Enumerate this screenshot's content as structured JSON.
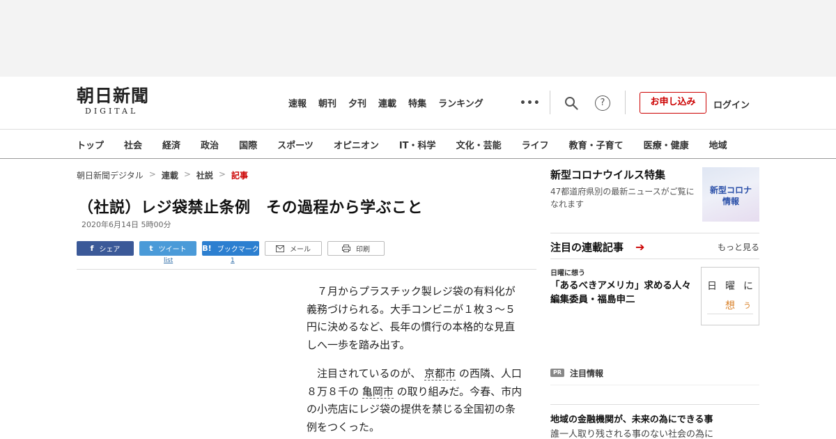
{
  "logo": {
    "main": "朝日新聞",
    "sub": "DIGITAL"
  },
  "topnav": [
    "速報",
    "朝刊",
    "夕刊",
    "連載",
    "特集",
    "ランキング"
  ],
  "header": {
    "more": "•••",
    "help": "?",
    "apply_label": "お申し込み",
    "login_label": "ログイン"
  },
  "catnav": [
    "トップ",
    "社会",
    "経済",
    "政治",
    "国際",
    "スポーツ",
    "オピニオン",
    "IT・科学",
    "文化・芸能",
    "ライフ",
    "教育・子育て",
    "医療・健康",
    "地域"
  ],
  "breadcrumb": [
    "朝日新聞デジタル",
    "連載",
    "社説",
    "記事"
  ],
  "breadcrumb_sep": ">",
  "article": {
    "title": "（社説）レジ袋禁止条例　その過程から学ぶこと",
    "date": "2020年6月14日 5時00分",
    "paragraphs": [
      {
        "before": "７月からプラスチック製レジ袋の有料化が義務づけられる。大手コンビニが１枚３～５円に決めるなど、長年の慣行の本格的な見直しへ一歩を踏み出す。"
      },
      {
        "before": "注目されているのが、",
        "link1": "京都市",
        "mid": "の西隣、人口８万８千の",
        "link2": "亀岡市",
        "after": "の取り組みだ。今春、市内の小売店にレジ袋の提供を禁じる全国初の条例をつくった。"
      }
    ]
  },
  "share": {
    "facebook": {
      "icon": "f",
      "label": "シェア"
    },
    "twitter": {
      "icon": "t",
      "label": "ツイート",
      "count": "list"
    },
    "hatena": {
      "icon": "B!",
      "label": "ブックマーク",
      "count": "1"
    },
    "mail": {
      "label": "メール"
    },
    "print": {
      "label": "印刷"
    }
  },
  "sidebar": {
    "covid": {
      "title": "新型コロナウイルス特集",
      "desc": "47都道府県別の最新ニュースがご覧になれます",
      "thumb_line1": "新型コロナ",
      "thumb_line2": "情報"
    },
    "series": {
      "title": "注目の連載記事",
      "more": "もっと見る",
      "category": "日曜に想う",
      "headline": "「あるべきアメリカ」求める人々　編集委員・福島申二",
      "thumb": {
        "k1": "日",
        "k2": "曜",
        "k3": "に",
        "k4": "想",
        "k5": "う"
      }
    },
    "pr": {
      "badge": "PR",
      "label": "注目情報",
      "headline": "地域の金融機関が、未来の為にできる事",
      "sub": "誰一人取り残される事のない社会の為に"
    }
  },
  "colors": {
    "accent": "#cc0000",
    "facebook": "#3b5998",
    "twitter": "#4a9ad8",
    "hatena": "#2c7fd0"
  }
}
